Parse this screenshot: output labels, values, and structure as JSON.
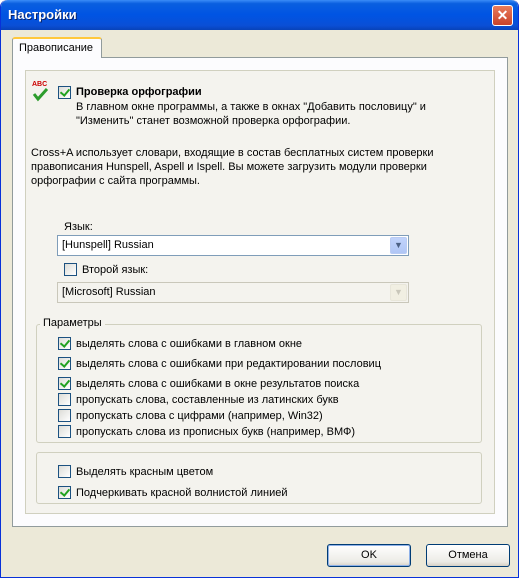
{
  "window": {
    "title": "Настройки",
    "close_icon": "✕"
  },
  "tabs": [
    {
      "label": "Правописание"
    }
  ],
  "spellcheck": {
    "icon_text": "ABC",
    "label": "Проверка орфографии",
    "checked": true,
    "desc_line1": "В главном окне программы, а также в окнах \"Добавить пословицу\" и",
    "desc_line2": "\"Изменить\" станет возможной проверка орфографии."
  },
  "info": {
    "line1": "Cross+A использует словари, входящие в состав бесплатных систем проверки",
    "line2": "правописания Hunspell, Aspell и Ispell. Вы можете загрузить модули проверки",
    "line3": "орфографии с сайта программы."
  },
  "language": {
    "label": "Язык:",
    "value": "[Hunspell] Russian"
  },
  "second_language": {
    "label": "Второй язык:",
    "checked": false,
    "value": "[Microsoft] Russian"
  },
  "params": {
    "title": "Параметры",
    "items": [
      {
        "label": "выделять слова с ошибками в главном окне",
        "checked": true
      },
      {
        "label": "выделять слова с ошибками при редактировании пословиц",
        "checked": true
      },
      {
        "label": "выделять слова с ошибками в окне результатов поиска",
        "checked": true
      },
      {
        "label": "пропускать слова, составленные из латинских букв",
        "checked": false
      },
      {
        "label": "пропускать слова с цифрами (например, Win32)",
        "checked": false
      },
      {
        "label": "пропускать слова из прописных букв (например, ВМФ)",
        "checked": false
      }
    ]
  },
  "highlight": {
    "items": [
      {
        "label": "Выделять красным цветом",
        "checked": false
      },
      {
        "label": "Подчеркивать красной волнистой линией",
        "checked": true
      }
    ]
  },
  "buttons": {
    "ok": "OK",
    "cancel": "Отмена"
  }
}
